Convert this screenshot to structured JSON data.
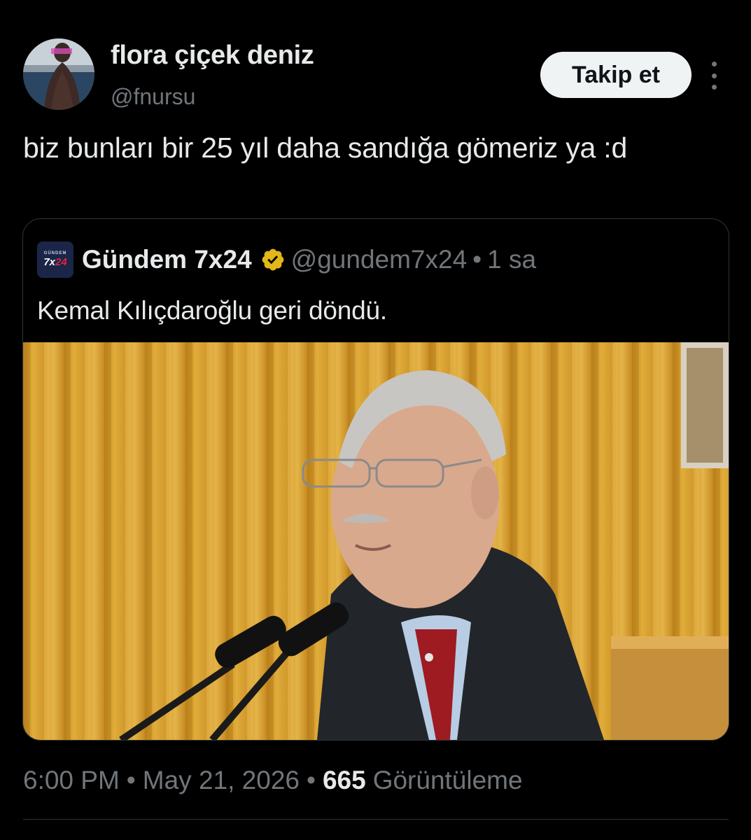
{
  "tweet": {
    "author": {
      "display_name": "flora çiçek deniz",
      "handle": "@fnursu"
    },
    "follow_label": "Takip et",
    "more_icon": "more-vertical-icon",
    "text": "biz bunları bir 25 yıl daha sandığa gömeriz ya :d",
    "meta": {
      "time": "6:00 PM",
      "separator": "•",
      "date": "May 21, 2026",
      "views_count": "665",
      "views_label": "Görüntüleme"
    }
  },
  "quote": {
    "avatar_logo": {
      "top": "GÜNDEM",
      "main_prefix": "7x",
      "main_suffix": "24"
    },
    "display_name": "Gündem 7x24",
    "verified_icon": "verified-badge-icon",
    "handle": "@gundem7x24",
    "separator": "•",
    "time": "1 sa",
    "text": "Kemal Kılıçdaroğlu geri döndü."
  },
  "colors": {
    "background": "#000000",
    "text_primary": "#e7e9ea",
    "text_secondary": "#71767b",
    "follow_button_bg": "#eff3f4",
    "verified_gold": "#e2b719",
    "border": "#2f3336"
  }
}
